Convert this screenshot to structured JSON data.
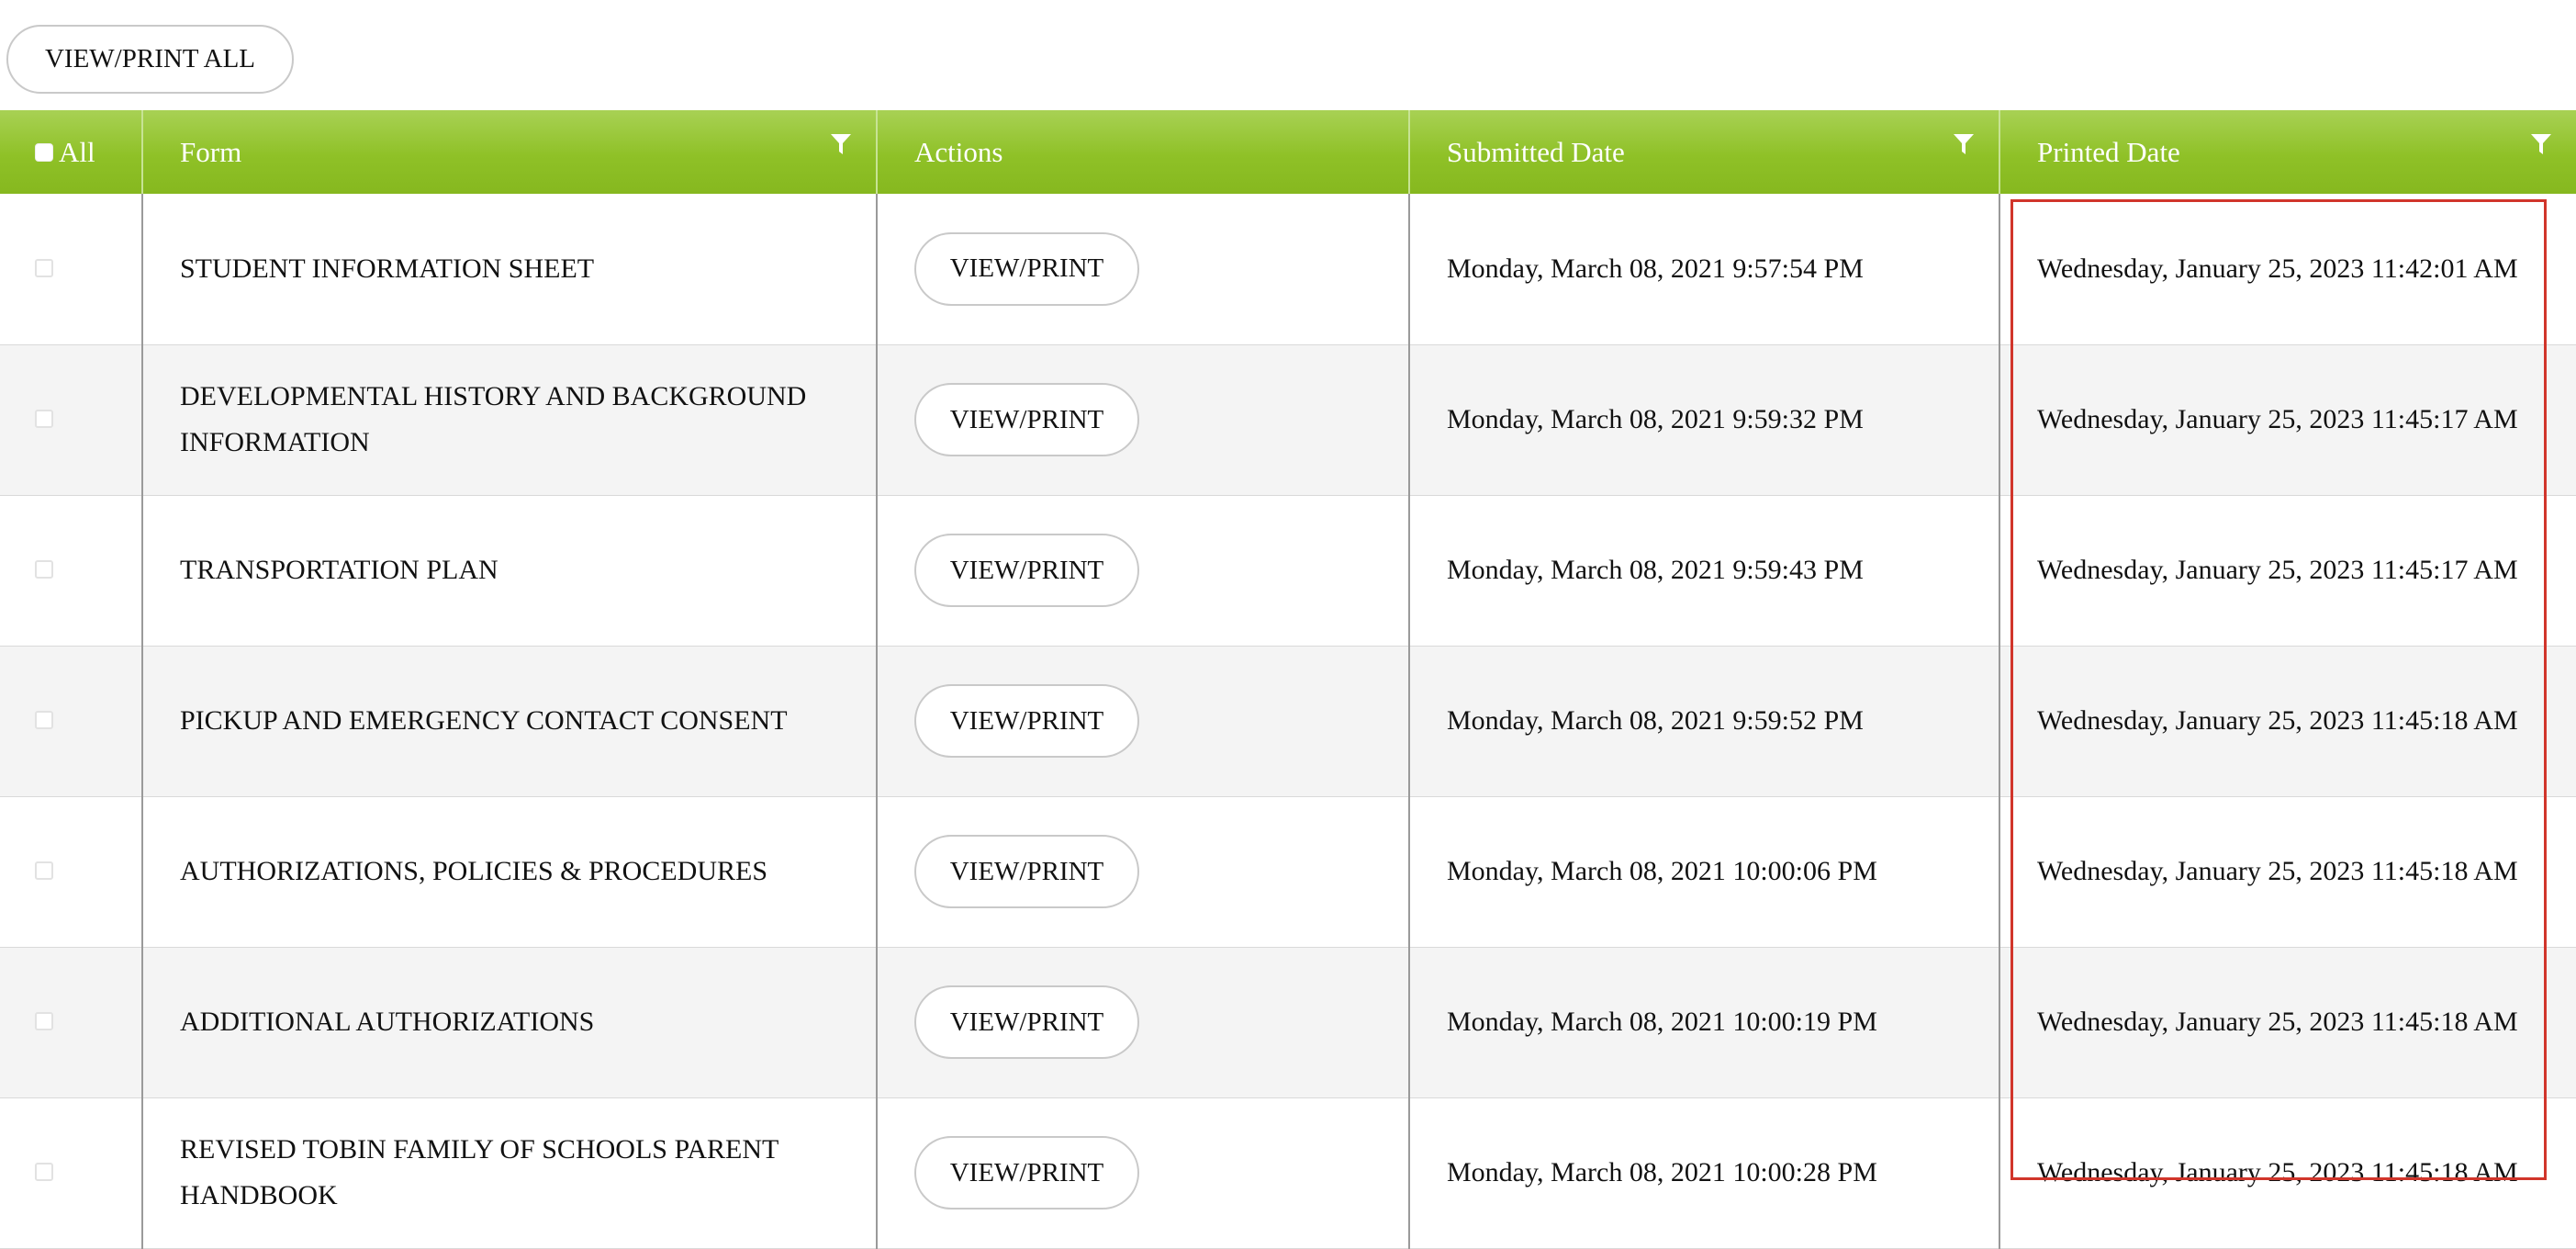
{
  "toolbar": {
    "view_print_all_label": "VIEW/PRINT ALL"
  },
  "table": {
    "headers": {
      "all": "All",
      "form": "Form",
      "actions": "Actions",
      "submitted": "Submitted Date",
      "printed": "Printed Date"
    },
    "rows": [
      {
        "form": "STUDENT INFORMATION SHEET",
        "action": "VIEW/PRINT",
        "submitted": "Monday, March 08, 2021 9:57:54 PM",
        "printed": "Wednesday, January 25, 2023 11:42:01 AM"
      },
      {
        "form": "DEVELOPMENTAL HISTORY AND BACKGROUND INFORMATION",
        "action": "VIEW/PRINT",
        "submitted": "Monday, March 08, 2021 9:59:32 PM",
        "printed": "Wednesday, January 25, 2023 11:45:17 AM"
      },
      {
        "form": "TRANSPORTATION PLAN",
        "action": "VIEW/PRINT",
        "submitted": "Monday, March 08, 2021 9:59:43 PM",
        "printed": "Wednesday, January 25, 2023 11:45:17 AM"
      },
      {
        "form": "PICKUP AND EMERGENCY CONTACT CONSENT",
        "action": "VIEW/PRINT",
        "submitted": "Monday, March 08, 2021 9:59:52 PM",
        "printed": "Wednesday, January 25, 2023 11:45:18 AM"
      },
      {
        "form": "AUTHORIZATIONS, POLICIES & PROCEDURES",
        "action": "VIEW/PRINT",
        "submitted": "Monday, March 08, 2021 10:00:06 PM",
        "printed": "Wednesday, January 25, 2023 11:45:18 AM"
      },
      {
        "form": "ADDITIONAL AUTHORIZATIONS",
        "action": "VIEW/PRINT",
        "submitted": "Monday, March 08, 2021 10:00:19 PM",
        "printed": "Wednesday, January 25, 2023 11:45:18 AM"
      },
      {
        "form": "REVISED TOBIN FAMILY OF SCHOOLS PARENT HANDBOOK",
        "action": "VIEW/PRINT",
        "submitted": "Monday, March 08, 2021 10:00:28 PM",
        "printed": "Wednesday, January 25, 2023 11:45:18 AM"
      }
    ]
  },
  "icons": {
    "filter": "filter-icon"
  },
  "colors": {
    "header_green": "#8fc127",
    "highlight_red": "#d1352b"
  }
}
